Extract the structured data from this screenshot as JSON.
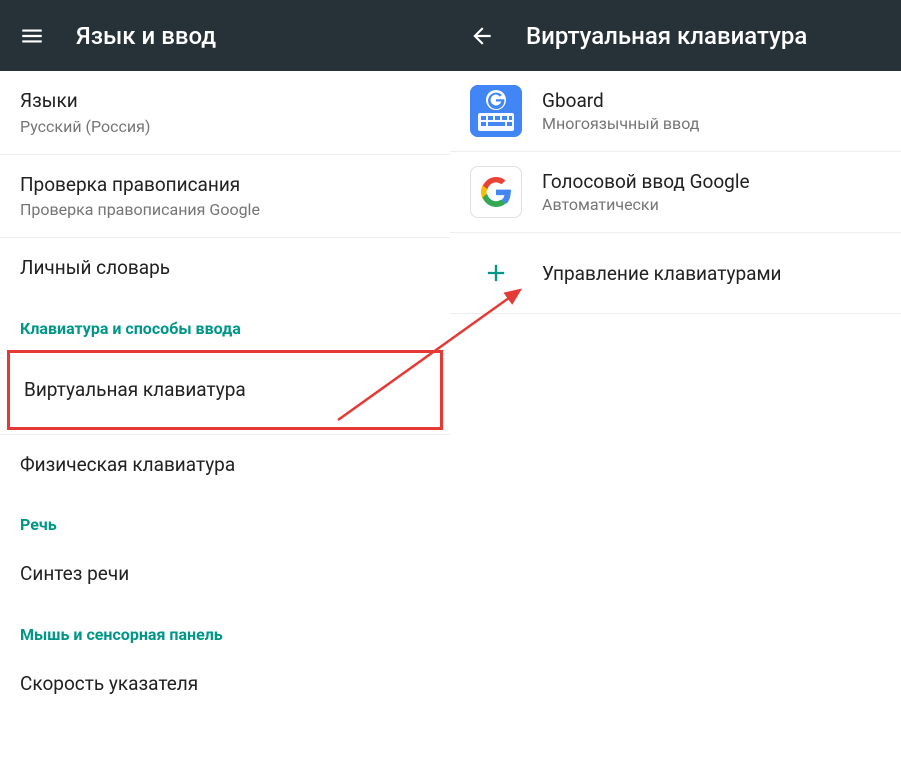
{
  "left": {
    "title": "Язык и ввод",
    "items": {
      "languages": {
        "primary": "Языки",
        "secondary": "Русский (Россия)"
      },
      "spellcheck": {
        "primary": "Проверка правописания",
        "secondary": "Проверка правописания Google"
      },
      "personal_dictionary": {
        "primary": "Личный словарь"
      }
    },
    "sections": {
      "keyboard": "Клавиатура и способы ввода",
      "speech": "Речь",
      "mouse": "Мышь и сенсорная панель"
    },
    "keyboard_items": {
      "virtual": {
        "primary": "Виртуальная клавиатура"
      },
      "physical": {
        "primary": "Физическая клавиатура"
      }
    },
    "speech_items": {
      "tts": {
        "primary": "Синтез речи"
      }
    },
    "mouse_items": {
      "pointer_speed": {
        "primary": "Скорость указателя"
      }
    }
  },
  "right": {
    "title": "Виртуальная клавиатура",
    "items": {
      "gboard": {
        "primary": "Gboard",
        "secondary": "Многоязычный ввод"
      },
      "google_voice": {
        "primary": "Голосовой ввод Google",
        "secondary": "Автоматически"
      },
      "manage": {
        "primary": "Управление клавиатурами"
      }
    }
  }
}
